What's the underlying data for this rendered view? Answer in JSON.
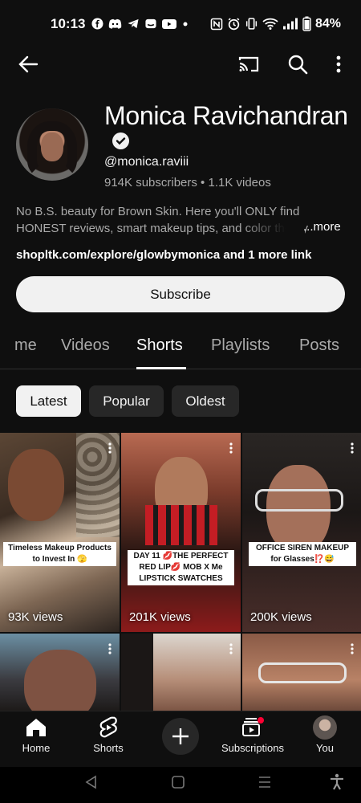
{
  "status_bar": {
    "time": "10:13",
    "battery": "84%",
    "notification_icons": [
      "facebook-icon",
      "discord-icon",
      "telegram-icon",
      "messenger-icon",
      "youtube-icon",
      "dot-icon"
    ],
    "system_icons": [
      "nfc-icon",
      "alarm-icon",
      "vibrate-icon",
      "wifi-icon",
      "signal-icon",
      "battery-icon"
    ]
  },
  "appbar": {
    "icons": [
      "back-arrow-icon",
      "cast-icon",
      "search-icon",
      "more-vert-icon"
    ]
  },
  "channel": {
    "name": "Monica Ravichandran",
    "handle": "@monica.raviii",
    "meta": "914K subscribers • 1.1K videos",
    "description": "No B.S. beauty for Brown Skin. Here you'll ONLY find HONEST reviews, smart makeup tips, and color theory",
    "more_label": "...more",
    "link": "shopltk.com/explore/glowbymonica and 1 more link",
    "subscribe_label": "Subscribe"
  },
  "tabs": [
    {
      "label": "me",
      "active": false
    },
    {
      "label": "Videos",
      "active": false
    },
    {
      "label": "Shorts",
      "active": true
    },
    {
      "label": "Playlists",
      "active": false
    },
    {
      "label": "Posts",
      "active": false
    }
  ],
  "filters": [
    {
      "label": "Latest",
      "active": true
    },
    {
      "label": "Popular",
      "active": false
    },
    {
      "label": "Oldest",
      "active": false
    }
  ],
  "shorts": [
    {
      "caption": "Timeless Makeup Products to Invest In 🫣",
      "views": "93K views"
    },
    {
      "caption": "DAY 11 💋THE PERFECT RED LIP💋 MOB X Me LIPSTICK SWATCHES",
      "views": "201K views"
    },
    {
      "caption": "OFFICE SIREN MAKEUP for Glasses⁉️😅",
      "views": "200K views"
    },
    {
      "caption": "",
      "views": ""
    },
    {
      "caption": "",
      "views": ""
    },
    {
      "caption": "",
      "views": ""
    }
  ],
  "bottom_nav": [
    {
      "label": "Home",
      "icon": "home-icon"
    },
    {
      "label": "Shorts",
      "icon": "shorts-icon"
    },
    {
      "label": "",
      "icon": "create-plus-icon"
    },
    {
      "label": "Subscriptions",
      "icon": "subscriptions-icon"
    },
    {
      "label": "You",
      "icon": "profile-avatar-icon"
    }
  ],
  "colors": {
    "background": "#0f0f0f",
    "text_primary": "#f1f1f1",
    "text_secondary": "#aaaaaa",
    "chip": "#272727",
    "notification_dot": "#ff0033"
  }
}
